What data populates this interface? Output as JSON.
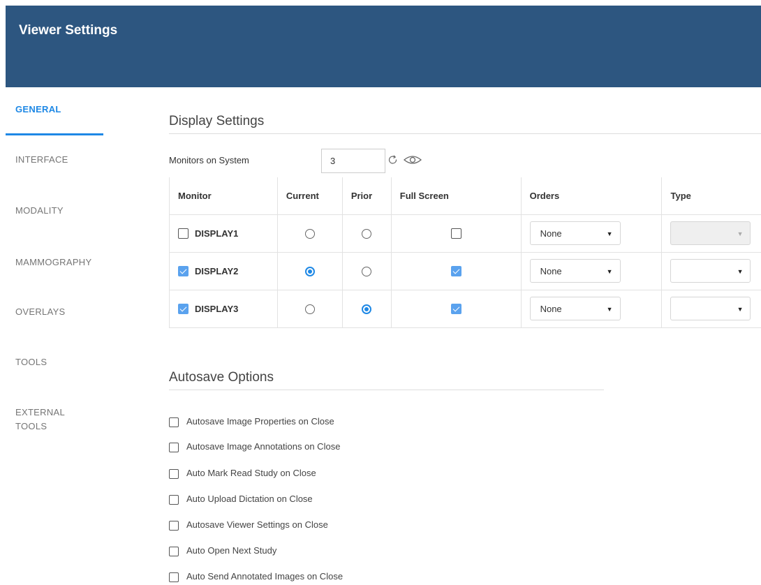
{
  "header": {
    "title": "Viewer Settings"
  },
  "sidebar": {
    "items": [
      {
        "label": "GENERAL"
      },
      {
        "label": "INTERFACE"
      },
      {
        "label": "MODALITY"
      },
      {
        "label": "MAMMOGRAPHY"
      },
      {
        "label": "OVERLAYS"
      },
      {
        "label": "TOOLS"
      },
      {
        "label": "EXTERNAL"
      },
      {
        "label": "TOOLS"
      }
    ],
    "active": "GENERAL"
  },
  "display": {
    "title": "Display Settings",
    "monitors_label": "Monitors on System",
    "monitors_value": "3",
    "columns": [
      "Monitor",
      "Current",
      "Prior",
      "Full Screen",
      "Orders",
      "Type"
    ],
    "rows": [
      {
        "name": "DISPLAY1",
        "enabled": false,
        "current": false,
        "prior": false,
        "full_screen": false,
        "orders": "None",
        "type": "",
        "type_disabled": true
      },
      {
        "name": "DISPLAY2",
        "enabled": true,
        "current": true,
        "prior": false,
        "full_screen": true,
        "orders": "None",
        "type": "",
        "type_disabled": false
      },
      {
        "name": "DISPLAY3",
        "enabled": true,
        "current": false,
        "prior": true,
        "full_screen": true,
        "orders": "None",
        "type": "",
        "type_disabled": false
      }
    ]
  },
  "autosave": {
    "title": "Autosave Options",
    "options": [
      {
        "label": "Autosave Image Properties on Close",
        "checked": false
      },
      {
        "label": "Autosave Image Annotations on Close",
        "checked": false
      },
      {
        "label": "Auto Mark Read Study on Close",
        "checked": false
      },
      {
        "label": "Auto Upload Dictation on Close",
        "checked": false
      },
      {
        "label": "Autosave Viewer Settings on Close",
        "checked": false
      },
      {
        "label": "Auto Open Next Study",
        "checked": false
      },
      {
        "label": "Auto Send Annotated Images on Close",
        "checked": false
      }
    ]
  },
  "colors": {
    "header_bg": "#2d5680",
    "accent": "#1e88e5",
    "checkbox_checked": "#5aa2ee"
  },
  "icons": {
    "refresh": "refresh-icon",
    "preview": "eye-icon",
    "dropdown": "chevron-down-icon"
  }
}
